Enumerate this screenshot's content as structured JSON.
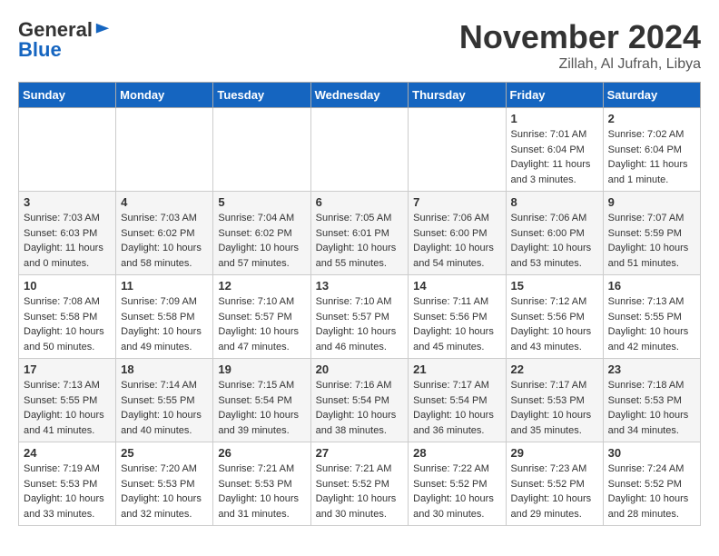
{
  "header": {
    "logo_general": "General",
    "logo_blue": "Blue",
    "month_title": "November 2024",
    "location": "Zillah, Al Jufrah, Libya"
  },
  "columns": [
    "Sunday",
    "Monday",
    "Tuesday",
    "Wednesday",
    "Thursday",
    "Friday",
    "Saturday"
  ],
  "weeks": [
    {
      "cells": [
        {
          "day": "",
          "content": ""
        },
        {
          "day": "",
          "content": ""
        },
        {
          "day": "",
          "content": ""
        },
        {
          "day": "",
          "content": ""
        },
        {
          "day": "",
          "content": ""
        },
        {
          "day": "1",
          "content": "Sunrise: 7:01 AM\nSunset: 6:04 PM\nDaylight: 11 hours\nand 3 minutes."
        },
        {
          "day": "2",
          "content": "Sunrise: 7:02 AM\nSunset: 6:04 PM\nDaylight: 11 hours\nand 1 minute."
        }
      ]
    },
    {
      "cells": [
        {
          "day": "3",
          "content": "Sunrise: 7:03 AM\nSunset: 6:03 PM\nDaylight: 11 hours\nand 0 minutes."
        },
        {
          "day": "4",
          "content": "Sunrise: 7:03 AM\nSunset: 6:02 PM\nDaylight: 10 hours\nand 58 minutes."
        },
        {
          "day": "5",
          "content": "Sunrise: 7:04 AM\nSunset: 6:02 PM\nDaylight: 10 hours\nand 57 minutes."
        },
        {
          "day": "6",
          "content": "Sunrise: 7:05 AM\nSunset: 6:01 PM\nDaylight: 10 hours\nand 55 minutes."
        },
        {
          "day": "7",
          "content": "Sunrise: 7:06 AM\nSunset: 6:00 PM\nDaylight: 10 hours\nand 54 minutes."
        },
        {
          "day": "8",
          "content": "Sunrise: 7:06 AM\nSunset: 6:00 PM\nDaylight: 10 hours\nand 53 minutes."
        },
        {
          "day": "9",
          "content": "Sunrise: 7:07 AM\nSunset: 5:59 PM\nDaylight: 10 hours\nand 51 minutes."
        }
      ]
    },
    {
      "cells": [
        {
          "day": "10",
          "content": "Sunrise: 7:08 AM\nSunset: 5:58 PM\nDaylight: 10 hours\nand 50 minutes."
        },
        {
          "day": "11",
          "content": "Sunrise: 7:09 AM\nSunset: 5:58 PM\nDaylight: 10 hours\nand 49 minutes."
        },
        {
          "day": "12",
          "content": "Sunrise: 7:10 AM\nSunset: 5:57 PM\nDaylight: 10 hours\nand 47 minutes."
        },
        {
          "day": "13",
          "content": "Sunrise: 7:10 AM\nSunset: 5:57 PM\nDaylight: 10 hours\nand 46 minutes."
        },
        {
          "day": "14",
          "content": "Sunrise: 7:11 AM\nSunset: 5:56 PM\nDaylight: 10 hours\nand 45 minutes."
        },
        {
          "day": "15",
          "content": "Sunrise: 7:12 AM\nSunset: 5:56 PM\nDaylight: 10 hours\nand 43 minutes."
        },
        {
          "day": "16",
          "content": "Sunrise: 7:13 AM\nSunset: 5:55 PM\nDaylight: 10 hours\nand 42 minutes."
        }
      ]
    },
    {
      "cells": [
        {
          "day": "17",
          "content": "Sunrise: 7:13 AM\nSunset: 5:55 PM\nDaylight: 10 hours\nand 41 minutes."
        },
        {
          "day": "18",
          "content": "Sunrise: 7:14 AM\nSunset: 5:55 PM\nDaylight: 10 hours\nand 40 minutes."
        },
        {
          "day": "19",
          "content": "Sunrise: 7:15 AM\nSunset: 5:54 PM\nDaylight: 10 hours\nand 39 minutes."
        },
        {
          "day": "20",
          "content": "Sunrise: 7:16 AM\nSunset: 5:54 PM\nDaylight: 10 hours\nand 38 minutes."
        },
        {
          "day": "21",
          "content": "Sunrise: 7:17 AM\nSunset: 5:54 PM\nDaylight: 10 hours\nand 36 minutes."
        },
        {
          "day": "22",
          "content": "Sunrise: 7:17 AM\nSunset: 5:53 PM\nDaylight: 10 hours\nand 35 minutes."
        },
        {
          "day": "23",
          "content": "Sunrise: 7:18 AM\nSunset: 5:53 PM\nDaylight: 10 hours\nand 34 minutes."
        }
      ]
    },
    {
      "cells": [
        {
          "day": "24",
          "content": "Sunrise: 7:19 AM\nSunset: 5:53 PM\nDaylight: 10 hours\nand 33 minutes."
        },
        {
          "day": "25",
          "content": "Sunrise: 7:20 AM\nSunset: 5:53 PM\nDaylight: 10 hours\nand 32 minutes."
        },
        {
          "day": "26",
          "content": "Sunrise: 7:21 AM\nSunset: 5:53 PM\nDaylight: 10 hours\nand 31 minutes."
        },
        {
          "day": "27",
          "content": "Sunrise: 7:21 AM\nSunset: 5:52 PM\nDaylight: 10 hours\nand 30 minutes."
        },
        {
          "day": "28",
          "content": "Sunrise: 7:22 AM\nSunset: 5:52 PM\nDaylight: 10 hours\nand 30 minutes."
        },
        {
          "day": "29",
          "content": "Sunrise: 7:23 AM\nSunset: 5:52 PM\nDaylight: 10 hours\nand 29 minutes."
        },
        {
          "day": "30",
          "content": "Sunrise: 7:24 AM\nSunset: 5:52 PM\nDaylight: 10 hours\nand 28 minutes."
        }
      ]
    }
  ]
}
